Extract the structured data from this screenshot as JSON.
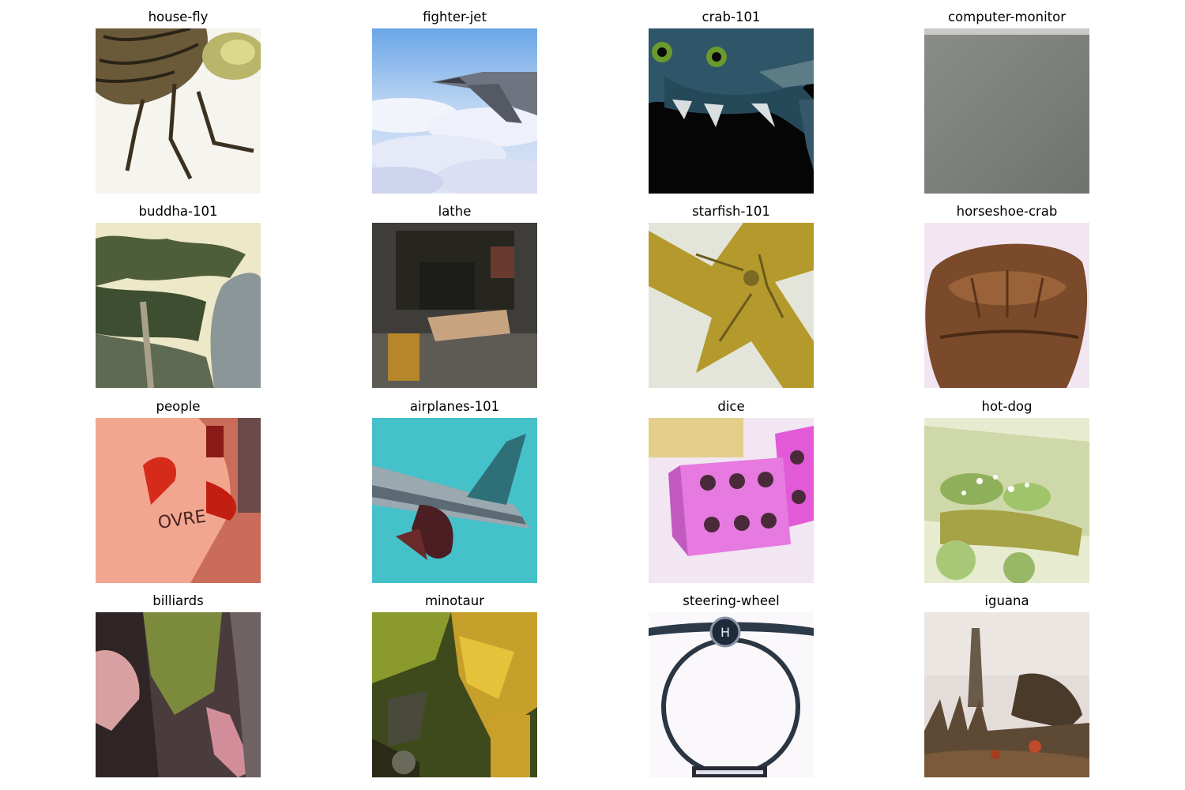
{
  "figure": {
    "tiles": [
      {
        "title": "house-fly"
      },
      {
        "title": "fighter-jet"
      },
      {
        "title": "crab-101"
      },
      {
        "title": "computer-monitor"
      },
      {
        "title": "buddha-101"
      },
      {
        "title": "lathe"
      },
      {
        "title": "starfish-101"
      },
      {
        "title": "horseshoe-crab"
      },
      {
        "title": "people"
      },
      {
        "title": "airplanes-101"
      },
      {
        "title": "dice"
      },
      {
        "title": "hot-dog"
      },
      {
        "title": "billiards"
      },
      {
        "title": "minotaur"
      },
      {
        "title": "steering-wheel"
      },
      {
        "title": "iguana"
      }
    ]
  }
}
